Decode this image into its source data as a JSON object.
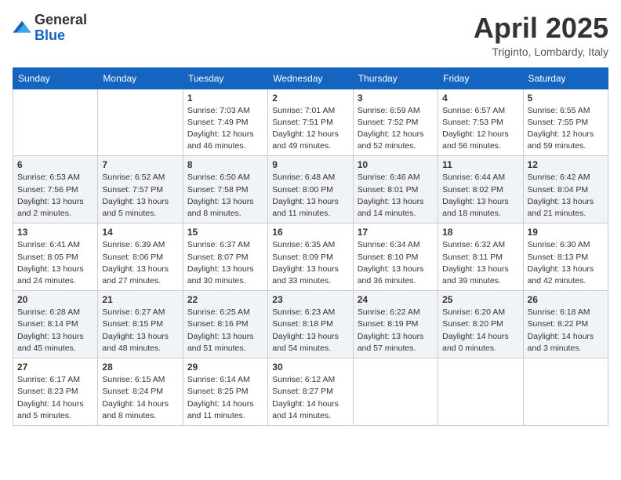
{
  "logo": {
    "general": "General",
    "blue": "Blue"
  },
  "title": "April 2025",
  "subtitle": "Triginto, Lombardy, Italy",
  "days_of_week": [
    "Sunday",
    "Monday",
    "Tuesday",
    "Wednesday",
    "Thursday",
    "Friday",
    "Saturday"
  ],
  "weeks": [
    [
      {
        "day": "",
        "info": ""
      },
      {
        "day": "",
        "info": ""
      },
      {
        "day": "1",
        "info": "Sunrise: 7:03 AM\nSunset: 7:49 PM\nDaylight: 12 hours\nand 46 minutes."
      },
      {
        "day": "2",
        "info": "Sunrise: 7:01 AM\nSunset: 7:51 PM\nDaylight: 12 hours\nand 49 minutes."
      },
      {
        "day": "3",
        "info": "Sunrise: 6:59 AM\nSunset: 7:52 PM\nDaylight: 12 hours\nand 52 minutes."
      },
      {
        "day": "4",
        "info": "Sunrise: 6:57 AM\nSunset: 7:53 PM\nDaylight: 12 hours\nand 56 minutes."
      },
      {
        "day": "5",
        "info": "Sunrise: 6:55 AM\nSunset: 7:55 PM\nDaylight: 12 hours\nand 59 minutes."
      }
    ],
    [
      {
        "day": "6",
        "info": "Sunrise: 6:53 AM\nSunset: 7:56 PM\nDaylight: 13 hours\nand 2 minutes."
      },
      {
        "day": "7",
        "info": "Sunrise: 6:52 AM\nSunset: 7:57 PM\nDaylight: 13 hours\nand 5 minutes."
      },
      {
        "day": "8",
        "info": "Sunrise: 6:50 AM\nSunset: 7:58 PM\nDaylight: 13 hours\nand 8 minutes."
      },
      {
        "day": "9",
        "info": "Sunrise: 6:48 AM\nSunset: 8:00 PM\nDaylight: 13 hours\nand 11 minutes."
      },
      {
        "day": "10",
        "info": "Sunrise: 6:46 AM\nSunset: 8:01 PM\nDaylight: 13 hours\nand 14 minutes."
      },
      {
        "day": "11",
        "info": "Sunrise: 6:44 AM\nSunset: 8:02 PM\nDaylight: 13 hours\nand 18 minutes."
      },
      {
        "day": "12",
        "info": "Sunrise: 6:42 AM\nSunset: 8:04 PM\nDaylight: 13 hours\nand 21 minutes."
      }
    ],
    [
      {
        "day": "13",
        "info": "Sunrise: 6:41 AM\nSunset: 8:05 PM\nDaylight: 13 hours\nand 24 minutes."
      },
      {
        "day": "14",
        "info": "Sunrise: 6:39 AM\nSunset: 8:06 PM\nDaylight: 13 hours\nand 27 minutes."
      },
      {
        "day": "15",
        "info": "Sunrise: 6:37 AM\nSunset: 8:07 PM\nDaylight: 13 hours\nand 30 minutes."
      },
      {
        "day": "16",
        "info": "Sunrise: 6:35 AM\nSunset: 8:09 PM\nDaylight: 13 hours\nand 33 minutes."
      },
      {
        "day": "17",
        "info": "Sunrise: 6:34 AM\nSunset: 8:10 PM\nDaylight: 13 hours\nand 36 minutes."
      },
      {
        "day": "18",
        "info": "Sunrise: 6:32 AM\nSunset: 8:11 PM\nDaylight: 13 hours\nand 39 minutes."
      },
      {
        "day": "19",
        "info": "Sunrise: 6:30 AM\nSunset: 8:13 PM\nDaylight: 13 hours\nand 42 minutes."
      }
    ],
    [
      {
        "day": "20",
        "info": "Sunrise: 6:28 AM\nSunset: 8:14 PM\nDaylight: 13 hours\nand 45 minutes."
      },
      {
        "day": "21",
        "info": "Sunrise: 6:27 AM\nSunset: 8:15 PM\nDaylight: 13 hours\nand 48 minutes."
      },
      {
        "day": "22",
        "info": "Sunrise: 6:25 AM\nSunset: 8:16 PM\nDaylight: 13 hours\nand 51 minutes."
      },
      {
        "day": "23",
        "info": "Sunrise: 6:23 AM\nSunset: 8:18 PM\nDaylight: 13 hours\nand 54 minutes."
      },
      {
        "day": "24",
        "info": "Sunrise: 6:22 AM\nSunset: 8:19 PM\nDaylight: 13 hours\nand 57 minutes."
      },
      {
        "day": "25",
        "info": "Sunrise: 6:20 AM\nSunset: 8:20 PM\nDaylight: 14 hours\nand 0 minutes."
      },
      {
        "day": "26",
        "info": "Sunrise: 6:18 AM\nSunset: 8:22 PM\nDaylight: 14 hours\nand 3 minutes."
      }
    ],
    [
      {
        "day": "27",
        "info": "Sunrise: 6:17 AM\nSunset: 8:23 PM\nDaylight: 14 hours\nand 5 minutes."
      },
      {
        "day": "28",
        "info": "Sunrise: 6:15 AM\nSunset: 8:24 PM\nDaylight: 14 hours\nand 8 minutes."
      },
      {
        "day": "29",
        "info": "Sunrise: 6:14 AM\nSunset: 8:25 PM\nDaylight: 14 hours\nand 11 minutes."
      },
      {
        "day": "30",
        "info": "Sunrise: 6:12 AM\nSunset: 8:27 PM\nDaylight: 14 hours\nand 14 minutes."
      },
      {
        "day": "",
        "info": ""
      },
      {
        "day": "",
        "info": ""
      },
      {
        "day": "",
        "info": ""
      }
    ]
  ]
}
